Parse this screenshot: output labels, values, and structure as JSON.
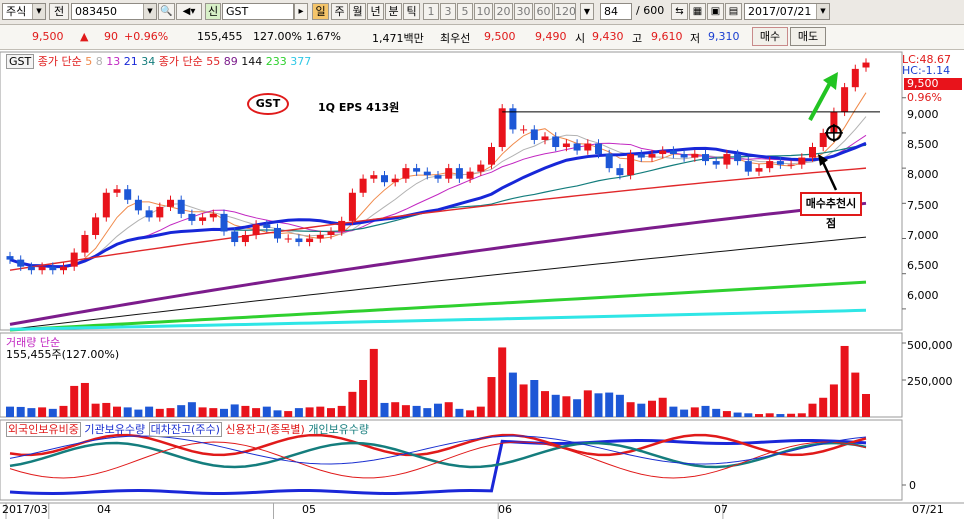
{
  "toolbar": {
    "market": "주식",
    "period": "전",
    "code": "083450",
    "badge": "신",
    "stock_name": "GST",
    "unit_active": "일",
    "units": [
      "주",
      "월",
      "년",
      "분",
      "틱"
    ],
    "numbers": [
      "1",
      "3",
      "5",
      "10",
      "20",
      "30",
      "60",
      "120"
    ],
    "count": "84",
    "total": "/ 600",
    "date": "2017/07/21"
  },
  "info": {
    "price": "9,500",
    "arrow": "▲",
    "change": "90",
    "change_pct": "+0.96%",
    "volume": "155,455",
    "volume_ratio": "127.00%",
    "turnover": "1.67%",
    "amount": "1,471백만",
    "best_label": "최우선",
    "best_ask": "9,500",
    "best_bid": "9,490",
    "open_label": "시",
    "open": "9,430",
    "high_label": "고",
    "high": "9,610",
    "low_label": "저",
    "low": "9,310",
    "buy_label": "매수",
    "sell_label": "매도"
  },
  "price_legend": {
    "name": "GST",
    "group1": "종가 단순",
    "ma1": [
      "5",
      "8",
      "13",
      "21",
      "34"
    ],
    "group2": "종가 단순",
    "ma2": [
      "55",
      "89",
      "144",
      "233",
      "377"
    ]
  },
  "volume_legend": {
    "title": "거래량 단순",
    "value": "155,455주(127.00%)"
  },
  "supply_legend": [
    "외국인보유비중",
    "기관보유수량",
    "대차잔고(주수)",
    "신용잔고(종목별)",
    "개인보유수량"
  ],
  "annotations": {
    "badge": "GST",
    "eps": "1Q EPS 413원",
    "buy_signal": "매수추천시점"
  },
  "axis": {
    "lc": "LC:48.67",
    "hc": "HC:-1.14",
    "cur_price": "9,500",
    "cur_pct": "0.96%",
    "price_ticks": [
      "9,000",
      "8,500",
      "8,000",
      "7,500",
      "7,000",
      "6,500",
      "6,000"
    ],
    "vol_ticks": [
      "500,000",
      "250,000"
    ],
    "supply_tick": "0",
    "dates": [
      "2017/03",
      "04",
      "05",
      "06",
      "07"
    ],
    "end_date": "07/21"
  },
  "colors": {
    "up": "#e8131b",
    "down": "#1d57d6",
    "ma5": "#f08a4b",
    "ma8": "#b2b2b2",
    "ma13": "#c228c2",
    "ma21": "#1727d8",
    "ma34": "#147d7d",
    "ma55": "#e0282a",
    "ma89": "#7c1c8c",
    "ma144": "#111111",
    "ma233": "#2fd02f",
    "ma377": "#2fe6e6"
  },
  "chart_data": {
    "type": "candlestick",
    "x": [
      "2017-03-27",
      "2017-03-28",
      "2017-03-29",
      "2017-03-30",
      "2017-03-31",
      "2017-04-03",
      "2017-04-04",
      "2017-04-05",
      "2017-04-06",
      "2017-04-07",
      "2017-04-10",
      "2017-04-11",
      "2017-04-12",
      "2017-04-13",
      "2017-04-14",
      "2017-04-17",
      "2017-04-18",
      "2017-04-19",
      "2017-04-20",
      "2017-04-21",
      "2017-04-24",
      "2017-04-25",
      "2017-04-26",
      "2017-04-27",
      "2017-04-28",
      "2017-05-01",
      "2017-05-02",
      "2017-05-04",
      "2017-05-08",
      "2017-05-10",
      "2017-05-11",
      "2017-05-12",
      "2017-05-15",
      "2017-05-16",
      "2017-05-17",
      "2017-05-18",
      "2017-05-19",
      "2017-05-22",
      "2017-05-23",
      "2017-05-24",
      "2017-05-25",
      "2017-05-26",
      "2017-05-29",
      "2017-05-30",
      "2017-05-31",
      "2017-06-01",
      "2017-06-02",
      "2017-06-05",
      "2017-06-07",
      "2017-06-08",
      "2017-06-09",
      "2017-06-12",
      "2017-06-13",
      "2017-06-14",
      "2017-06-15",
      "2017-06-16",
      "2017-06-19",
      "2017-06-20",
      "2017-06-21",
      "2017-06-22",
      "2017-06-23",
      "2017-06-26",
      "2017-06-27",
      "2017-06-28",
      "2017-06-29",
      "2017-06-30",
      "2017-07-03",
      "2017-07-04",
      "2017-07-05",
      "2017-07-06",
      "2017-07-07",
      "2017-07-10",
      "2017-07-11",
      "2017-07-12",
      "2017-07-13",
      "2017-07-14",
      "2017-07-17",
      "2017-07-18",
      "2017-07-19",
      "2017-07-20",
      "2017-07-21"
    ],
    "open": [
      6750,
      6700,
      6600,
      6550,
      6600,
      6550,
      6600,
      6800,
      7050,
      7300,
      7650,
      7700,
      7550,
      7400,
      7300,
      7450,
      7550,
      7350,
      7250,
      7300,
      7350,
      7100,
      6950,
      7050,
      7200,
      7150,
      7000,
      7000,
      6950,
      7000,
      7050,
      7100,
      7250,
      7650,
      7850,
      7900,
      7800,
      7850,
      8000,
      7950,
      7900,
      7850,
      8000,
      7850,
      7950,
      8050,
      8300,
      8850,
      8550,
      8550,
      8400,
      8450,
      8300,
      8350,
      8250,
      8350,
      8200,
      8000,
      7900,
      8200,
      8150,
      8200,
      8250,
      8200,
      8150,
      8200,
      8100,
      8050,
      8200,
      8100,
      7950,
      8000,
      8100,
      8050,
      8050,
      8150,
      8300,
      8500,
      8800,
      9150,
      9430
    ],
    "close": [
      6700,
      6600,
      6550,
      6600,
      6550,
      6600,
      6800,
      7050,
      7300,
      7650,
      7700,
      7550,
      7400,
      7300,
      7450,
      7550,
      7350,
      7250,
      7300,
      7350,
      7100,
      6950,
      7050,
      7200,
      7150,
      7000,
      7000,
      6950,
      7000,
      7050,
      7100,
      7250,
      7650,
      7850,
      7900,
      7800,
      7850,
      8000,
      7950,
      7900,
      7850,
      8000,
      7850,
      7950,
      8050,
      8300,
      8850,
      8550,
      8550,
      8400,
      8450,
      8300,
      8350,
      8250,
      8350,
      8200,
      8000,
      7900,
      8200,
      8150,
      8200,
      8250,
      8200,
      8150,
      8200,
      8100,
      8050,
      8200,
      8100,
      7950,
      8000,
      8100,
      8050,
      8050,
      8150,
      8300,
      8500,
      8800,
      9150,
      9410,
      9500
    ],
    "volume": [
      70000,
      68000,
      60000,
      65000,
      55000,
      75000,
      210000,
      230000,
      90000,
      95000,
      70000,
      65000,
      50000,
      70000,
      55000,
      60000,
      80000,
      100000,
      65000,
      60000,
      55000,
      85000,
      75000,
      60000,
      70000,
      45000,
      40000,
      60000,
      65000,
      70000,
      60000,
      75000,
      170000,
      250000,
      460000,
      95000,
      100000,
      80000,
      75000,
      60000,
      90000,
      100000,
      55000,
      45000,
      70000,
      270000,
      470000,
      300000,
      220000,
      250000,
      175000,
      150000,
      140000,
      120000,
      180000,
      160000,
      165000,
      150000,
      100000,
      90000,
      110000,
      130000,
      70000,
      50000,
      65000,
      75000,
      55000,
      40000,
      30000,
      25000,
      20000,
      25000,
      20000,
      22000,
      25000,
      90000,
      130000,
      220000,
      480000,
      300000,
      155455
    ],
    "price_axis": [
      5700,
      9650
    ],
    "volume_axis": [
      0,
      500000
    ]
  }
}
